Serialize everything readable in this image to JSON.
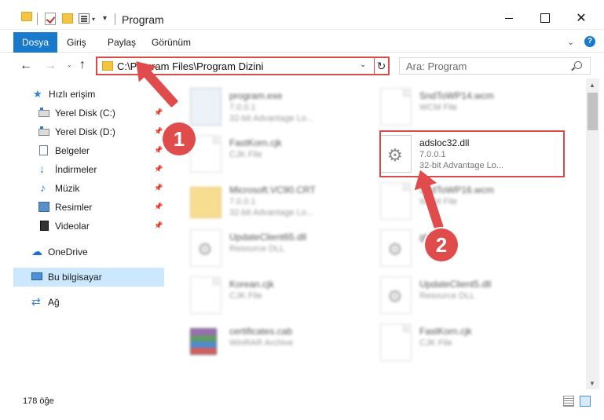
{
  "window": {
    "title": "Program",
    "close_glyph": "✕"
  },
  "quick_access_toolbar": {
    "customize_glyph": "▾"
  },
  "ribbon": {
    "tabs": [
      {
        "label": "Dosya",
        "active": true
      },
      {
        "label": "Giriş"
      },
      {
        "label": "Paylaş"
      },
      {
        "label": "Görünüm"
      }
    ],
    "expand_glyph": "⌄",
    "help_glyph": "?"
  },
  "navigation": {
    "back_glyph": "←",
    "forward_glyph": "→",
    "recent_glyph": "⌄",
    "up_glyph": "↑",
    "address": "C:\\Program Files\\Program Dizini",
    "address_dropdown_glyph": "⌄",
    "refresh_glyph": "↻",
    "search_placeholder": "Ara: Program"
  },
  "sidebar": {
    "items": [
      {
        "label": "Hızlı erişim",
        "icon": "star-icon",
        "glyph": "★"
      },
      {
        "label": "Yerel Disk (C:)",
        "icon": "drive-icon",
        "pinned": true
      },
      {
        "label": "Yerel Disk (D:)",
        "icon": "drive-icon",
        "pinned": true
      },
      {
        "label": "Belgeler",
        "icon": "documents-icon",
        "pinned": true
      },
      {
        "label": "İndirmeler",
        "icon": "download-icon",
        "glyph": "↓",
        "pinned": true
      },
      {
        "label": "Müzik",
        "icon": "music-icon",
        "glyph": "♪",
        "pinned": true
      },
      {
        "label": "Resimler",
        "icon": "pictures-icon",
        "pinned": true
      },
      {
        "label": "Videolar",
        "icon": "videos-icon",
        "pinned": true
      },
      {
        "label": "OneDrive",
        "icon": "cloud-icon",
        "glyph": "☁"
      },
      {
        "label": "Bu bilgisayar",
        "icon": "computer-icon",
        "selected": true
      },
      {
        "label": "Ağ",
        "icon": "network-icon",
        "glyph": "⇄"
      }
    ],
    "pin_glyph": "📌"
  },
  "files": [
    {
      "name": "program.exe",
      "line2": "7.0.0.1",
      "line3": "32-bit Advantage Lo...",
      "icon": "exe-icon",
      "blurred": true
    },
    {
      "name": "SndToWP14.wcm",
      "line2": "WCM File",
      "line3": "",
      "icon": "file-icon",
      "blurred": true
    },
    {
      "name": "FastKorn.cjk",
      "line2": "CJK File",
      "line3": "",
      "icon": "file-icon",
      "blurred": true
    },
    {
      "name": "adsloc32.dll",
      "line2": "7.0.0.1",
      "line3": "32-bit Advantage Lo...",
      "icon": "dll-gear-icon",
      "blurred": false
    },
    {
      "name": "Microsoft.VC90.CRT",
      "line2": "7.0.0.1",
      "line3": "32-bit Advantage Lo...",
      "icon": "folder-icon",
      "blurred": true
    },
    {
      "name": "SndToWP16.wcm",
      "line2": "WCM File",
      "line3": "",
      "icon": "file-icon",
      "blurred": true
    },
    {
      "name": "UpdateClient65.dll",
      "line2": "Resource DLL",
      "line3": "",
      "icon": "dll-gear-icon",
      "blurred": true
    },
    {
      "name": "gbg",
      "line2": "",
      "line3": "",
      "icon": "dll-gear-icon",
      "blurred": true
    },
    {
      "name": "Korean.cjk",
      "line2": "CJK File",
      "line3": "",
      "icon": "file-icon",
      "blurred": true
    },
    {
      "name": "UpdateClient5.dll",
      "line2": "Resource DLL",
      "line3": "",
      "icon": "dll-gear-icon",
      "blurred": true
    },
    {
      "name": "certificates.cab",
      "line2": "WinRAR Archive",
      "line3": "",
      "icon": "archive-icon",
      "blurred": true
    },
    {
      "name": "FastKorn.cjk",
      "line2": "CJK File",
      "line3": "",
      "icon": "file-icon",
      "blurred": true
    }
  ],
  "annotations": {
    "badge1": "1",
    "badge2": "2",
    "color": "#e04b4b"
  },
  "scrollbar": {
    "up_glyph": "▲",
    "down_glyph": "▼"
  },
  "status": {
    "item_count": "178 öğe"
  }
}
